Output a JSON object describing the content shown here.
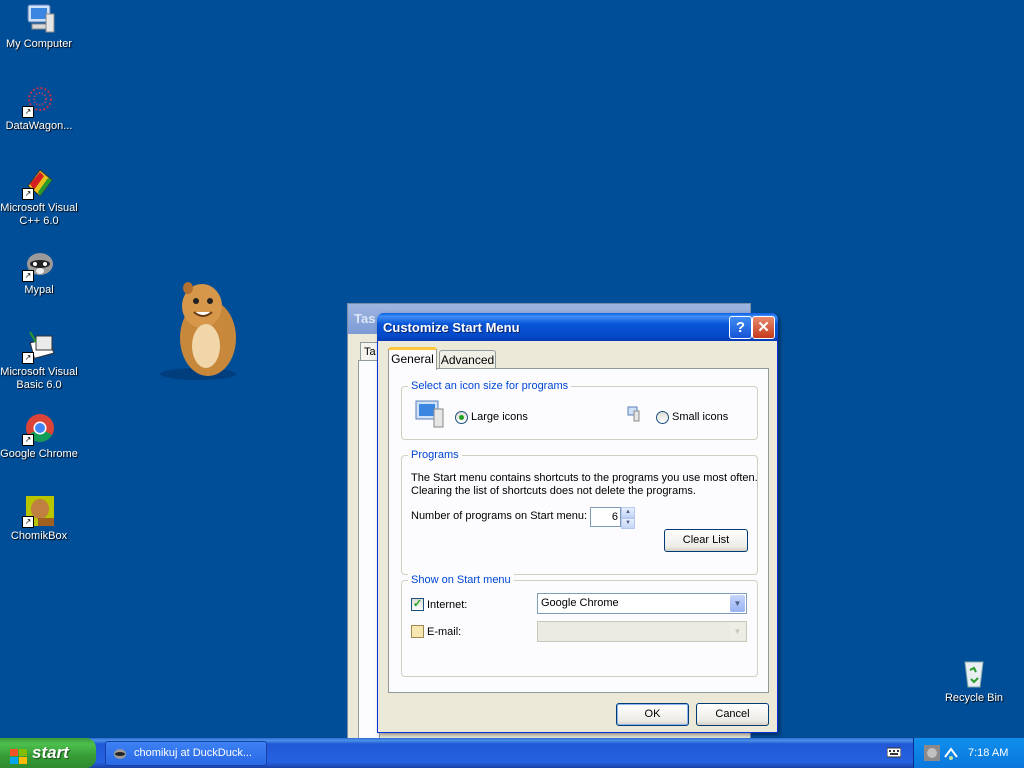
{
  "desktop": {
    "icons": [
      {
        "label": "My Computer"
      },
      {
        "label": "DataWagon..."
      },
      {
        "label": "Microsoft Visual C++ 6.0"
      },
      {
        "label": "Mypal"
      },
      {
        "label": "Microsoft Visual Basic 6.0"
      },
      {
        "label": "Google Chrome"
      },
      {
        "label": "ChomikBox"
      },
      {
        "label": "Recycle Bin"
      }
    ]
  },
  "background_dialog": {
    "title_fragment": "Tas",
    "tab_fragment": "Ta"
  },
  "dialog": {
    "title": "Customize Start Menu",
    "help": "?",
    "close": "✕",
    "tabs": [
      {
        "label": "General"
      },
      {
        "label": "Advanced"
      }
    ],
    "icon_size_group": {
      "title": "Select an icon size for programs",
      "large": "Large icons",
      "small": "Small icons",
      "selected": "Large icons"
    },
    "programs_group": {
      "title": "Programs",
      "description_line1": "The Start menu contains shortcuts to the programs you use most often.",
      "description_line2": "Clearing the list of shortcuts does not delete the programs.",
      "count_label": "Number of programs on Start menu:",
      "count_value": "6",
      "clear_button": "Clear List"
    },
    "show_group": {
      "title": "Show on Start menu",
      "internet_label": "Internet:",
      "internet_checked": true,
      "internet_value": "Google Chrome",
      "email_label": "E-mail:",
      "email_checked": false,
      "email_value": ""
    },
    "ok": "OK",
    "cancel": "Cancel"
  },
  "taskbar": {
    "start": "start",
    "task_item": "chomikuj at DuckDuck...",
    "clock": "7:18 AM"
  },
  "colors": {
    "desktop": "#004e98",
    "title_blue": "#0854d6",
    "group_title": "#0046d5",
    "start_green": "#3c9a3c"
  }
}
